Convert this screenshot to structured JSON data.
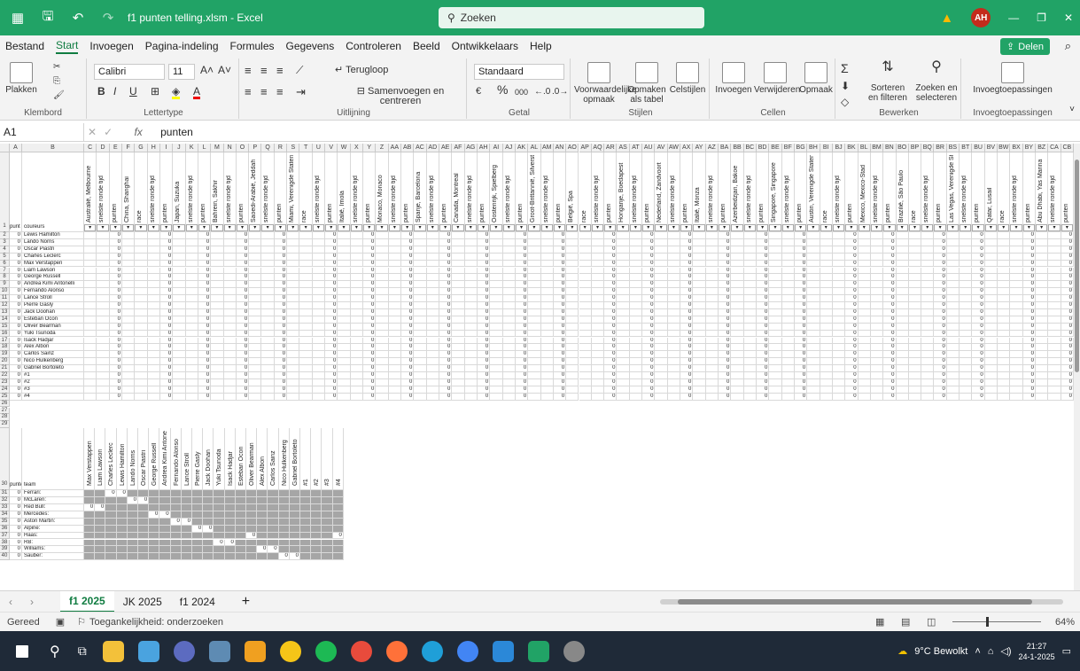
{
  "window": {
    "title": "f1 punten telling.xlsm - Excel",
    "search_placeholder": "Zoeken",
    "avatar": "AH"
  },
  "menu": [
    "Bestand",
    "Start",
    "Invoegen",
    "Pagina-indeling",
    "Formules",
    "Gegevens",
    "Controleren",
    "Beeld",
    "Ontwikkelaars",
    "Help"
  ],
  "menu_active": "Start",
  "share_label": "Delen",
  "ribbon": {
    "clipboard": {
      "paste": "Plakken",
      "label": "Klembord"
    },
    "font": {
      "name": "Calibri",
      "size": "11",
      "label": "Lettertype",
      "buttons": [
        "B",
        "I",
        "U"
      ]
    },
    "alignment": {
      "wrap": "Terugloop",
      "merge": "Samenvoegen en centreren",
      "label": "Uitlijning"
    },
    "number": {
      "format": "Standaard",
      "label": "Getal",
      "pct": "%",
      "thousands": "000"
    },
    "styles": {
      "items": [
        "Voorwaardelijke opmaak",
        "Opmaken als tabel",
        "Celstijlen"
      ],
      "label": "Stijlen"
    },
    "cells": {
      "items": [
        "Invoegen",
        "Verwijderen",
        "Opmaak"
      ],
      "label": "Cellen"
    },
    "editing": {
      "items": [
        "Sorteren en filteren",
        "Zoeken en selecteren"
      ],
      "label": "Bewerken",
      "sigma": "Σ"
    },
    "addins": {
      "item": "Invoegtoepassingen",
      "label": "Invoegtoepassingen"
    }
  },
  "formula_bar": {
    "cell": "A1",
    "fx": "fx",
    "value": "punten"
  },
  "columns": [
    "A",
    "B",
    "C",
    "D",
    "E",
    "F",
    "G",
    "H",
    "I",
    "J",
    "K",
    "L",
    "M",
    "N",
    "O",
    "P",
    "Q",
    "R",
    "S",
    "T",
    "U",
    "V",
    "W",
    "X",
    "Y",
    "Z",
    "AA",
    "AB",
    "AC",
    "AD",
    "AE",
    "AF",
    "AG",
    "AH",
    "AI",
    "AJ",
    "AK",
    "AL",
    "AM",
    "AN",
    "AO",
    "AP",
    "AQ",
    "AR",
    "AS",
    "AT",
    "AU",
    "AV",
    "AW",
    "AX",
    "AY",
    "AZ",
    "BA",
    "BB",
    "BC",
    "BD",
    "BE",
    "BF",
    "BG",
    "BH",
    "BI",
    "BJ",
    "BK",
    "BL",
    "BM",
    "BN",
    "BO",
    "BP",
    "BQ",
    "BR",
    "BS",
    "BT",
    "BU",
    "BV",
    "BW",
    "BX",
    "BY",
    "BZ",
    "CA",
    "CB"
  ],
  "header_row": {
    "a": "punt",
    "b": "coureurs"
  },
  "race_headers": [
    "Australië, Melbourne",
    "snelste ronde tijd",
    "punten",
    "China, Shanghai",
    "race",
    "snelste ronde tijd",
    "punten",
    "Japan, Suzuka",
    "snelste ronde tijd",
    "punten",
    "Bahrein, Sakhir",
    "snelste ronde tijd",
    "punten",
    "Saoedi-Arabië, Jeddah",
    "snelste ronde tijd",
    "punten",
    "Miami, Verenigde Staten",
    "race",
    "snelste ronde tijd",
    "punten",
    "Italië, Imola",
    "snelste ronde tijd",
    "punten",
    "Monaco, Monaco",
    "snelste ronde tijd",
    "punten",
    "Spanje, Barcelona",
    "snelste ronde tijd",
    "punten",
    "Canada, Montreal",
    "snelste ronde tijd",
    "punten",
    "Oostenrijk, Spielberg",
    "snelste ronde tijd",
    "punten",
    "Groot-Brittannië, Silverstone",
    "snelste ronde tijd",
    "punten",
    "België, Spa",
    "race",
    "snelste ronde tijd",
    "punten",
    "Hongarije, Boedapest",
    "snelste ronde tijd",
    "punten",
    "Nederland, Zandvoort",
    "snelste ronde tijd",
    "punten",
    "Italië, Monza",
    "snelste ronde tijd",
    "punten",
    "Azerbeidzjan, Bakoe",
    "snelste ronde tijd",
    "punten",
    "Singapore, Singapore",
    "snelste ronde tijd",
    "punten",
    "Austin, Verenigde Staten",
    "race",
    "snelste ronde tijd",
    "punten",
    "Mexico, Mexico-Stad",
    "snelste ronde tijd",
    "punten",
    "Brazilië, São Paulo",
    "race",
    "snelste ronde tijd",
    "punten",
    "Las Vegas, Verenigde Staten",
    "snelste ronde tijd",
    "punten",
    "Qatar, Lusail",
    "race",
    "snelste ronde tijd",
    "punten",
    "Abu Dhabi, Yas Marina",
    "snelste ronde tijd",
    "punten"
  ],
  "drivers": [
    "Lewis Hamilton",
    "Lando Norris",
    "Oscar Piastri",
    "Charles Leclerc",
    "Max Verstappen",
    "Liam Lawson",
    "George Russell",
    "Andrea Kimi Antonelli",
    "Fernando Alonso",
    "Lance Stroll",
    "Pierre Gasly",
    "Jack Doohan",
    "Esteban Ocon",
    "Oliver Bearman",
    "Yuki Tsunoda",
    "Isack Hadjar",
    "Alex Albon",
    "Carlos Sainz",
    "Nico Hulkenberg",
    "Gabriel Bortoleto",
    "#1",
    "#2",
    "#3",
    "#4"
  ],
  "zero": "0",
  "team_header": {
    "a": "punten",
    "b": "team"
  },
  "team_driver_cols": [
    "Max Verstappen",
    "Liam Lawson",
    "Charles Leclerc",
    "Lewis Hamilton",
    "Lando Norris",
    "Oscar Piastri",
    "George Russell",
    "Andrea Kimi Antonelli",
    "Fernando Alonso",
    "Lance Stroll",
    "Pierre Gasly",
    "Jack Doohan",
    "Yuki Tsunoda",
    "Isack Hadjar",
    "Esteban Ocon",
    "Oliver Bearman",
    "Alex Albon",
    "Carlos Sainz",
    "Nico Hulkenberg",
    "Gabriel Bortoleto",
    "#1",
    "#2",
    "#3",
    "#4"
  ],
  "teams": [
    "Ferrari:",
    "McLaren:",
    "Red Bull:",
    "Mercedes:",
    "Aston Martin:",
    "Alpine:",
    "Haas:",
    "RB:",
    "Williams:",
    "Sauber:"
  ],
  "sheets": [
    "f1 2025",
    "JK 2025",
    "f1 2024"
  ],
  "sheet_active": "f1 2025",
  "status": {
    "ready": "Gereed",
    "accessibility": "Toegankelijkheid: onderzoeken",
    "zoom": "64%"
  },
  "taskbar": {
    "weather": "9°C Bewolkt",
    "time": "21:27",
    "date": "24-1-2025"
  },
  "colors": {
    "excel_green": "#21a366",
    "gray_cell": "#a6a6a6"
  }
}
